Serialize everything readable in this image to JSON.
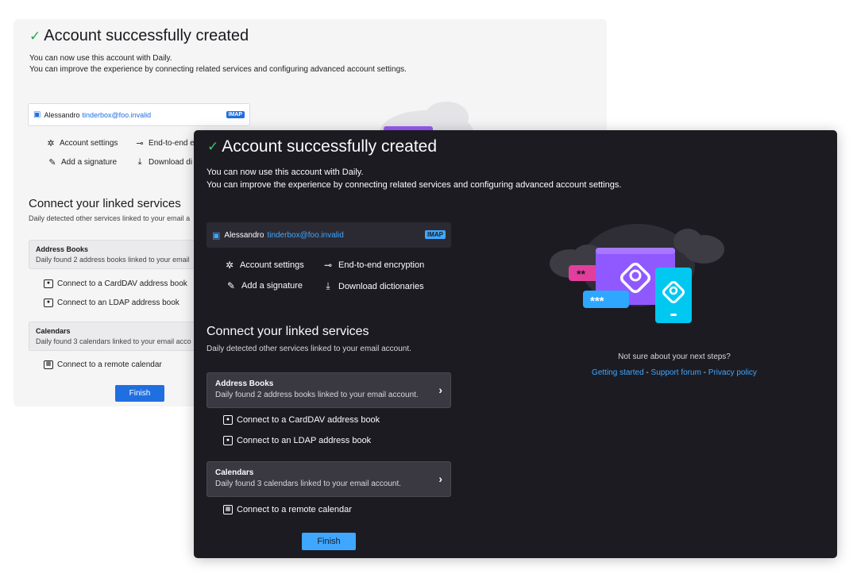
{
  "check_glyph": "✓",
  "title": "Account successfully created",
  "desc_line1": "You can now use this account with Daily.",
  "desc_line2": "You can improve the experience by connecting related services and configuring advanced account settings.",
  "account": {
    "name": "Alessandro",
    "email": "tinderbox@foo.invalid",
    "protocol": "IMAP"
  },
  "actions": {
    "settings": "Account settings",
    "encryption": "End-to-end encryption",
    "signature": "Add a signature",
    "dictionaries": "Download dictionaries"
  },
  "light_truncated": {
    "encryption": "End-to-end e",
    "dictionaries": "Download di",
    "sec_sub": "Daily detected other services linked to your email a",
    "ab_sub": "Daily found 2 address books linked to your email",
    "cal_sub": "Daily found 3 calendars linked to your email acco"
  },
  "linked": {
    "title": "Connect your linked services",
    "subtitle": "Daily detected other services linked to your email account.",
    "address_books": {
      "title": "Address Books",
      "subtitle": "Daily found 2 address books linked to your email account.",
      "links": [
        "Connect to a CardDAV address book",
        "Connect to an LDAP address book"
      ]
    },
    "calendars": {
      "title": "Calendars",
      "subtitle": "Daily found 3 calendars linked to your email account.",
      "links": [
        "Connect to a remote calendar"
      ]
    }
  },
  "finish_label": "Finish",
  "help": {
    "question": "Not sure about your next steps?",
    "links": [
      "Getting started",
      "Support forum",
      "Privacy policy"
    ],
    "separator": " - "
  },
  "chevron": "›",
  "art_text": {
    "password_stars_1": "**",
    "password_stars_2": "***"
  },
  "colors": {
    "accent_dark": "#3fa7ff",
    "accent_light": "#1f6fe0",
    "check": "#3fc26a",
    "panel_dark_bg": "#1c1b22",
    "panel_light_bg": "#f5f5f6"
  }
}
